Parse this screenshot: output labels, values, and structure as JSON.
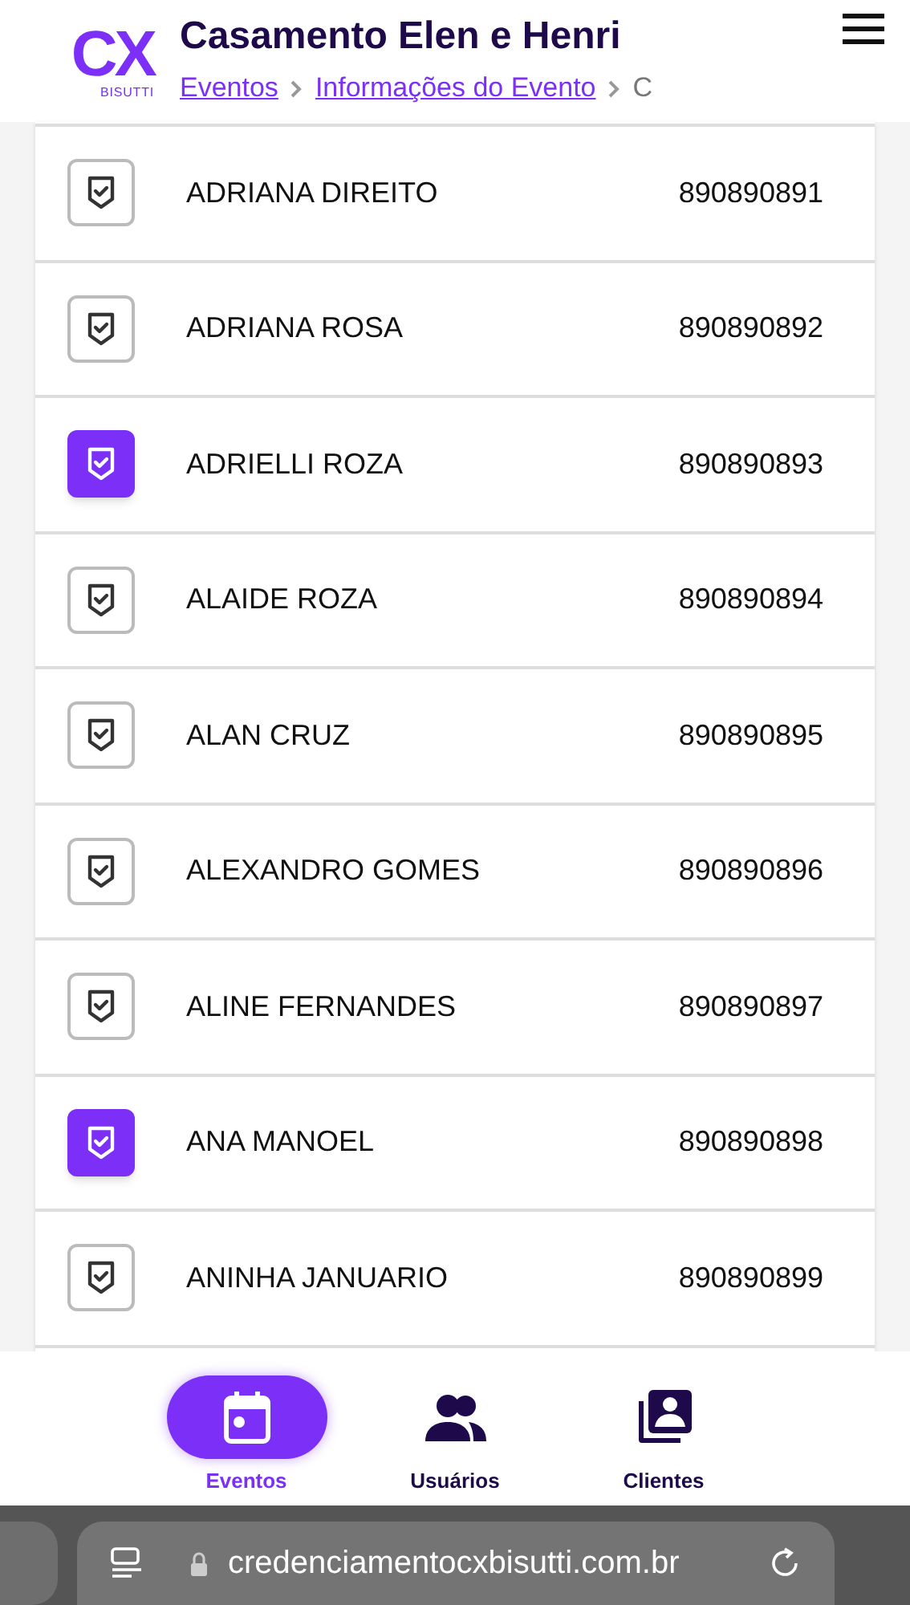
{
  "header": {
    "logo": {
      "mark": "CX",
      "subtitle": "BISUTTI"
    },
    "title": "Casamento Elen e Henri",
    "breadcrumbs": [
      {
        "label": "Eventos",
        "kind": "link"
      },
      {
        "label": "Informações do Evento",
        "kind": "link"
      },
      {
        "label": "C",
        "kind": "current"
      }
    ]
  },
  "guests": [
    {
      "name": "ADRIANA DIREITO",
      "code": "890890891",
      "checked": false
    },
    {
      "name": "ADRIANA ROSA",
      "code": "890890892",
      "checked": false
    },
    {
      "name": "ADRIELLI ROZA",
      "code": "890890893",
      "checked": true
    },
    {
      "name": "ALAIDE ROZA",
      "code": "890890894",
      "checked": false
    },
    {
      "name": "ALAN CRUZ",
      "code": "890890895",
      "checked": false
    },
    {
      "name": "ALEXANDRO GOMES",
      "code": "890890896",
      "checked": false
    },
    {
      "name": "ALINE FERNANDES",
      "code": "890890897",
      "checked": false
    },
    {
      "name": "ANA MANOEL",
      "code": "890890898",
      "checked": true
    },
    {
      "name": "ANINHA JANUARIO",
      "code": "890890899",
      "checked": false
    }
  ],
  "bottom_nav": [
    {
      "label": "Eventos",
      "kind": "calendar",
      "selected": true
    },
    {
      "label": "Usuários",
      "kind": "users",
      "selected": false
    },
    {
      "label": "Clientes",
      "kind": "contacts",
      "selected": false
    }
  ],
  "browser": {
    "url": "credenciamentocxbisutti.com.br"
  }
}
